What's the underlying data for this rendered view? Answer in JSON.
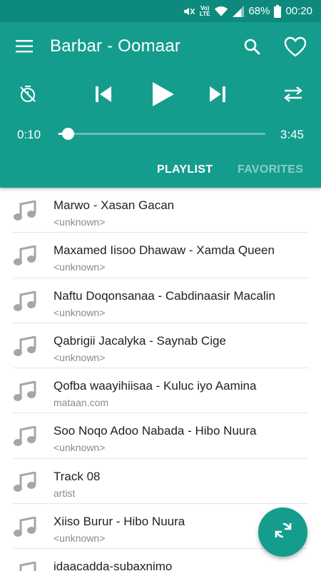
{
  "status_bar": {
    "lte_top": "Vo)",
    "lte_bottom": "LTE",
    "battery": "68%",
    "time": "00:20",
    "icons": [
      "mute-icon",
      "lte-icon",
      "wifi-icon",
      "signal-icon",
      "battery-icon"
    ]
  },
  "toolbar": {
    "title": "Barbar - Oomaar",
    "icons": [
      "menu-icon",
      "search-icon",
      "heart-icon"
    ]
  },
  "player": {
    "current_time": "0:10",
    "duration": "3:45",
    "progress": 0.044,
    "icons": [
      "timer-off-icon",
      "skip-previous-icon",
      "play-icon",
      "skip-next-icon",
      "repeat-icon"
    ]
  },
  "tabs": [
    {
      "label": "PLAYLIST",
      "active": true
    },
    {
      "label": "FAVORITES",
      "active": false
    }
  ],
  "playlist": [
    {
      "title": "Marwo - Xasan Gacan",
      "artist": "<unknown>"
    },
    {
      "title": "Maxamed Iisoo Dhawaw - Xamda Queen",
      "artist": "<unknown>"
    },
    {
      "title": "Naftu Doqonsanaa - Cabdinaasir Macalin",
      "artist": "<unknown>"
    },
    {
      "title": "Qabrigii Jacalyka - Saynab Cige",
      "artist": "<unknown>"
    },
    {
      "title": "Qofba waayihiisaa - Kuluc iyo Aamina",
      "artist": "mataan.com"
    },
    {
      "title": "Soo Noqo Adoo Nabada - Hibo Nuura",
      "artist": "<unknown>"
    },
    {
      "title": "Track 08",
      "artist": "artist"
    },
    {
      "title": "Xiiso Burur - Hibo Nuura",
      "artist": "<unknown>"
    },
    {
      "title": "idaacadda-subaxnimo",
      "artist": ""
    }
  ],
  "fab": {
    "icon": "sync-icon"
  },
  "colors": {
    "primary": "#149d8d",
    "status_bar": "#0e8a7c",
    "list_icon": "#a6a6a6",
    "secondary_text": "#8a8a8a"
  }
}
